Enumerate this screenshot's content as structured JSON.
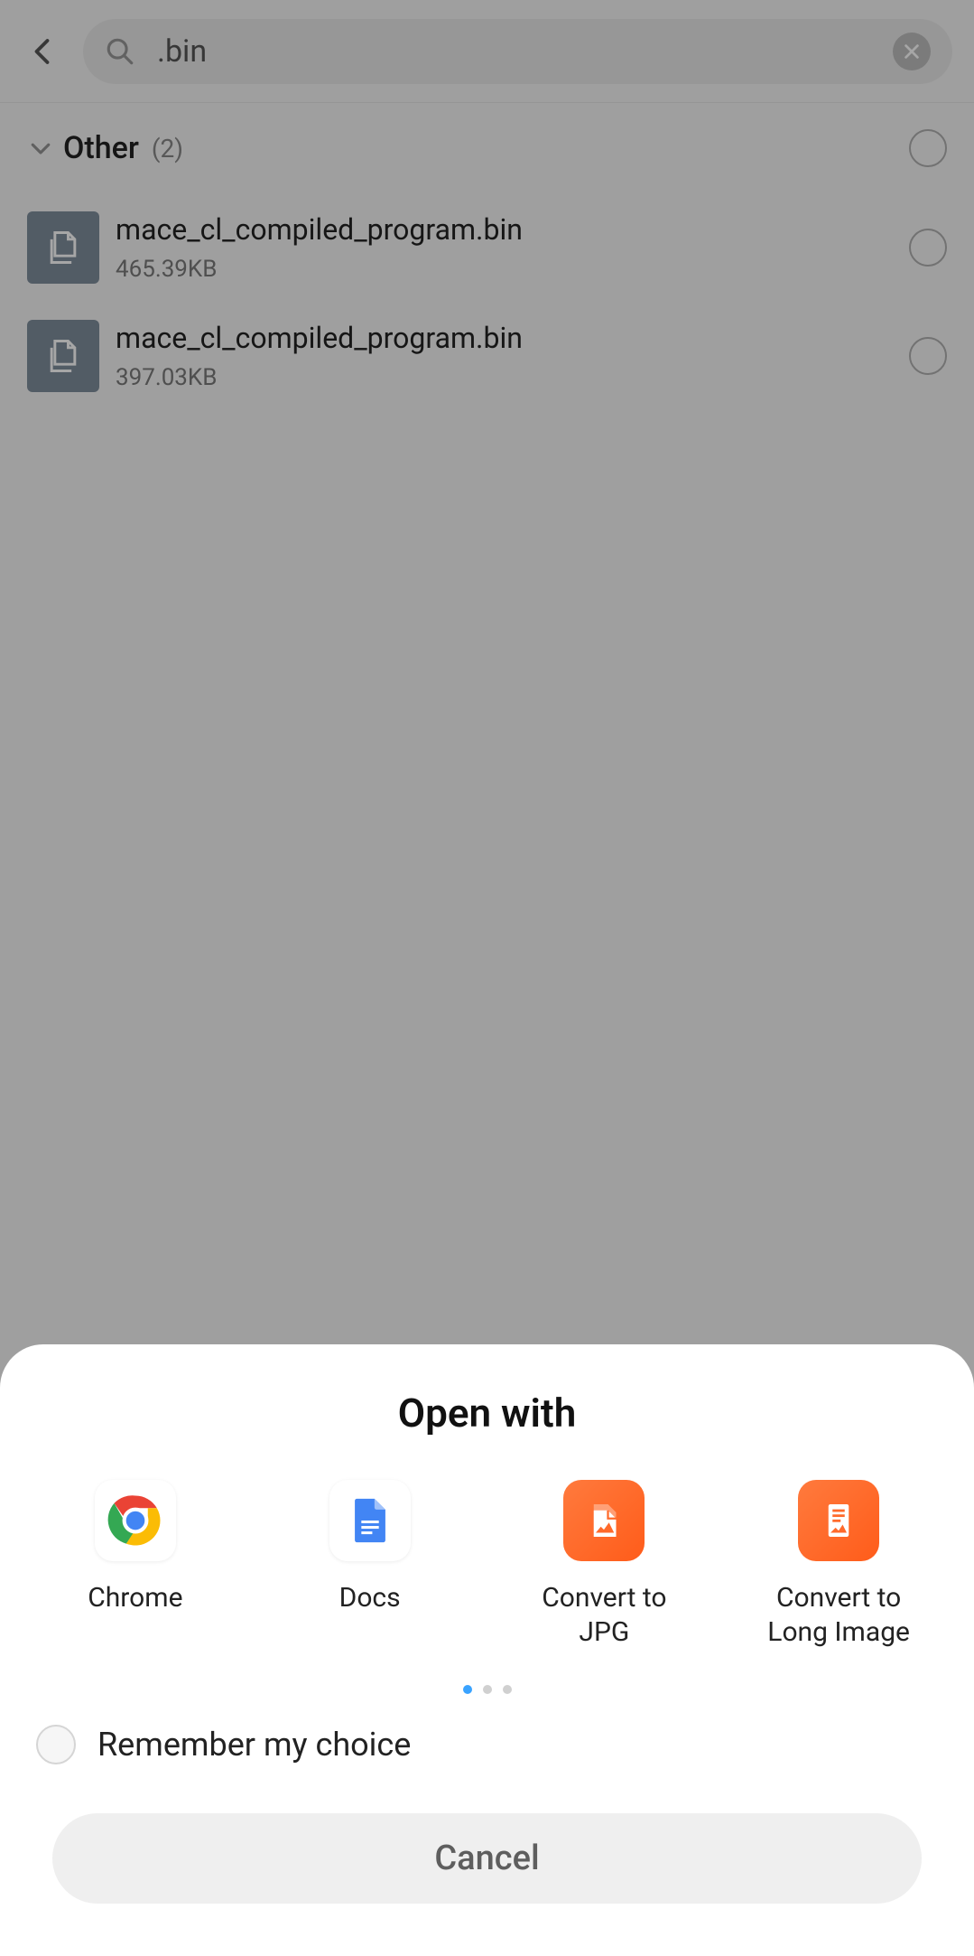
{
  "search": {
    "value": ".bin"
  },
  "group": {
    "title": "Other",
    "count": "(2)"
  },
  "files": [
    {
      "name": "mace_cl_compiled_program.bin",
      "size": "465.39KB"
    },
    {
      "name": "mace_cl_compiled_program.bin",
      "size": "397.03KB"
    }
  ],
  "sheet": {
    "title": "Open with",
    "apps": [
      {
        "label": "Chrome"
      },
      {
        "label": "Docs"
      },
      {
        "label": "Convert to JPG"
      },
      {
        "label": "Convert to Long Image"
      }
    ],
    "remember": "Remember my choice",
    "cancel": "Cancel"
  }
}
